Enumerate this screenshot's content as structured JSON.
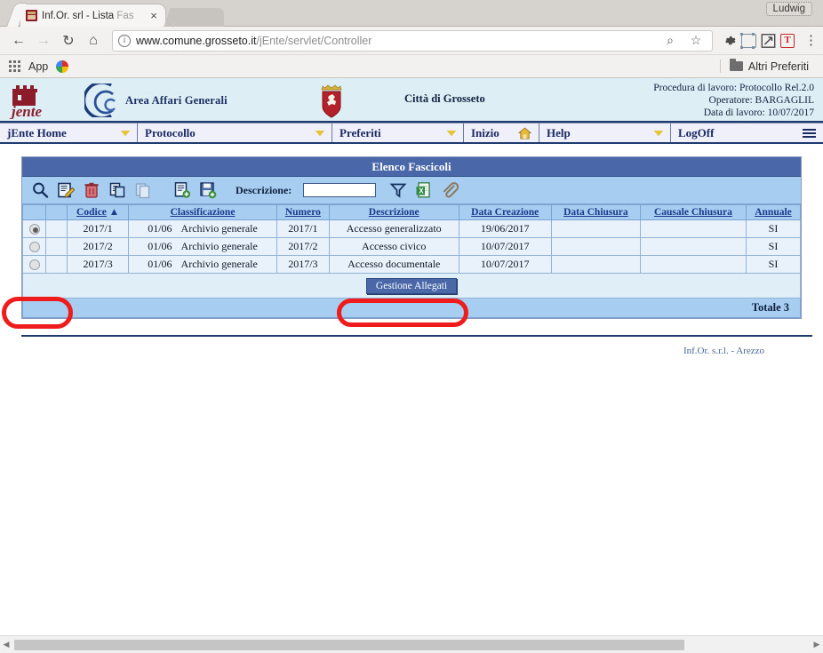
{
  "browser": {
    "tab": {
      "title_main": "Inf.Or. srl - Lista ",
      "title_faded": "Fas",
      "close_label": "×",
      "favicon_name": "jente-favicon"
    },
    "profile_name": "Ludwig",
    "nav": {
      "back": "←",
      "forward": "→",
      "reload": "↻",
      "home": "⌂"
    },
    "omnibox": {
      "info_glyph": "i",
      "url_bold": "www.comune.grosseto.it",
      "url_rest": "/jEnte/servlet/Controller",
      "zoom_glyph": "⌕",
      "star_glyph": "☆"
    },
    "toolbar_icons": [
      "gear-icon",
      "screenshot-icon",
      "resize-icon",
      "translate-icon",
      "menu-kebab-icon"
    ],
    "bookmarks": {
      "apps_label": "App",
      "photos_icon": "photos-icon",
      "other_label": "Altri Preferiti"
    }
  },
  "app_header": {
    "logo_alt": "jEnte",
    "area_label": "Area Affari Generali",
    "city_label": "Città di Grosseto",
    "info_lines": [
      "Procedura di lavoro: Protocollo Rel.2.0",
      "Operatore: BARGAGLIL",
      "Data di lavoro: 10/07/2017"
    ]
  },
  "menubar": [
    {
      "label": "jEnte Home",
      "caret": true,
      "name": "menu-jente-home"
    },
    {
      "label": "Protocollo",
      "caret": true,
      "name": "menu-protocollo"
    },
    {
      "label": "Preferiti",
      "caret": true,
      "name": "menu-preferiti"
    },
    {
      "label": "Inizio",
      "caret": false,
      "name": "menu-inizio"
    },
    {
      "label": "Help",
      "caret": true,
      "name": "menu-help"
    },
    {
      "label": "LogOff",
      "caret": false,
      "name": "menu-logoff"
    }
  ],
  "panel": {
    "title": "Elenco Fascicoli",
    "toolbar": {
      "icons": [
        "search-icon",
        "edit-icon",
        "delete-icon",
        "copy-icon",
        "duplicate-icon",
        "new-document-icon",
        "save-icon"
      ],
      "desc_label": "Descrizione:",
      "desc_value": "",
      "desc_placeholder": "",
      "filter_icon": "filter-icon",
      "excel_icon": "excel-export-icon",
      "attach_icon": "paperclip-icon"
    },
    "columns": [
      "Codice",
      "Classificazione",
      "Numero",
      "Descrizione",
      "Data Creazione",
      "Data Chiusura",
      "Causale Chiusura",
      "Annuale"
    ],
    "sort_indicator": "▲",
    "rows": [
      {
        "selected": true,
        "codice": "2017/1",
        "class_code": "01/06",
        "class_name": "Archivio generale",
        "numero": "2017/1",
        "descrizione": "Accesso generalizzato",
        "data_creazione": "19/06/2017",
        "data_chiusura": "",
        "causale_chiusura": "",
        "annuale": "SI"
      },
      {
        "selected": false,
        "codice": "2017/2",
        "class_code": "01/06",
        "class_name": "Archivio generale",
        "numero": "2017/2",
        "descrizione": "Accesso civico",
        "data_creazione": "10/07/2017",
        "data_chiusura": "",
        "causale_chiusura": "",
        "annuale": "SI"
      },
      {
        "selected": false,
        "codice": "2017/3",
        "class_code": "01/06",
        "class_name": "Archivio generale",
        "numero": "2017/3",
        "descrizione": "Accesso documentale",
        "data_creazione": "10/07/2017",
        "data_chiusura": "",
        "causale_chiusura": "",
        "annuale": "SI"
      }
    ],
    "allegati_button": "Gestione Allegati",
    "total_label": "Totale 3"
  },
  "footer": {
    "text": "Inf.Or. s.r.l. - Arezzo"
  },
  "annotations": {
    "accent_color": "#ee1c1c",
    "items": [
      {
        "name": "annot-selected-radio"
      },
      {
        "name": "annot-descrizione-cell"
      }
    ]
  }
}
